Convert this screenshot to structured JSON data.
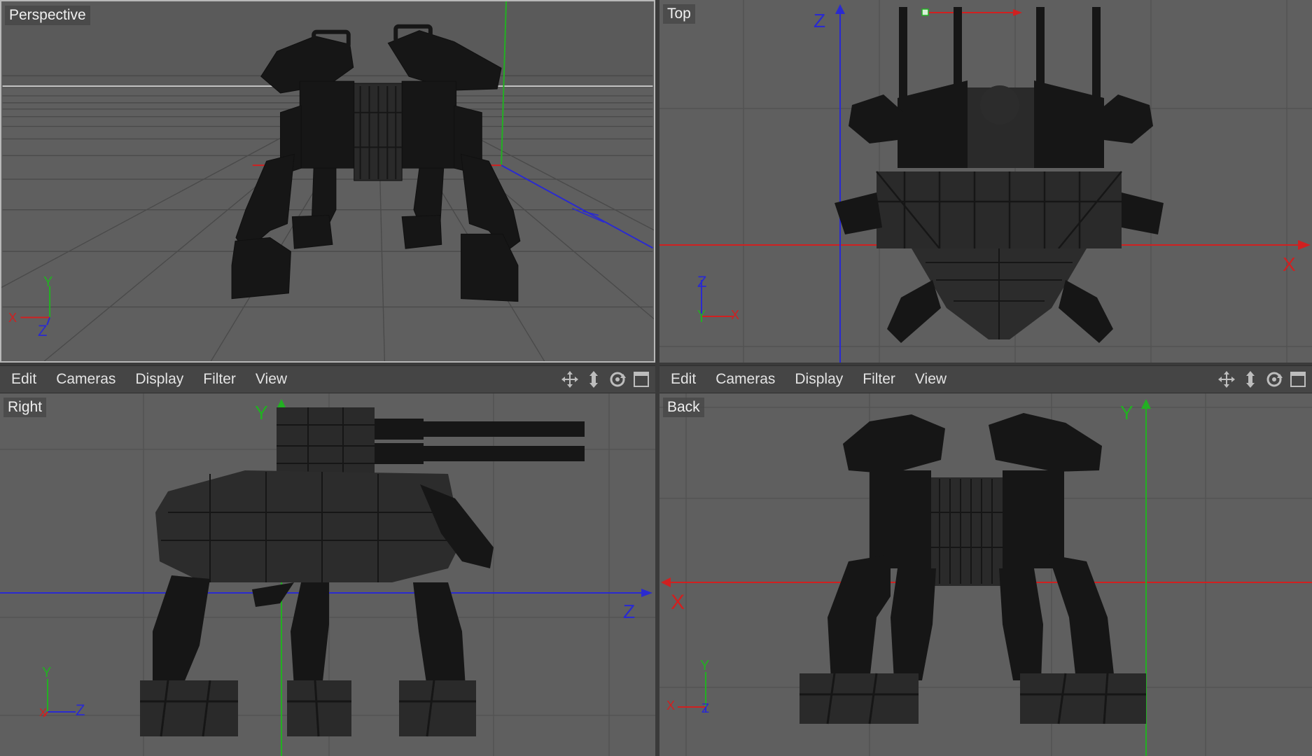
{
  "viewports": {
    "perspective": {
      "label": "Perspective"
    },
    "top": {
      "label": "Top",
      "axis_x": "X",
      "axis_z": "Z"
    },
    "right": {
      "label": "Right",
      "axis_y": "Y",
      "axis_z": "Z"
    },
    "back": {
      "label": "Back",
      "axis_y": "Y",
      "axis_x": "X"
    }
  },
  "gizmo": {
    "x": "X",
    "y": "Y",
    "z": "Z"
  },
  "menus": {
    "left": [
      "Edit",
      "Cameras",
      "Display",
      "Filter",
      "View"
    ],
    "right": [
      "Edit",
      "Cameras",
      "Display",
      "Filter",
      "View"
    ]
  },
  "icons": [
    "move-view-icon",
    "dolly-view-icon",
    "rotate-view-icon",
    "maximize-view-icon"
  ],
  "colors": {
    "viewport_bg": "#5f5f5f",
    "grid": "#535353",
    "axis_x": "#d02020",
    "axis_y": "#22b022",
    "axis_z": "#2a2ad0",
    "wireframe": "#161616"
  }
}
